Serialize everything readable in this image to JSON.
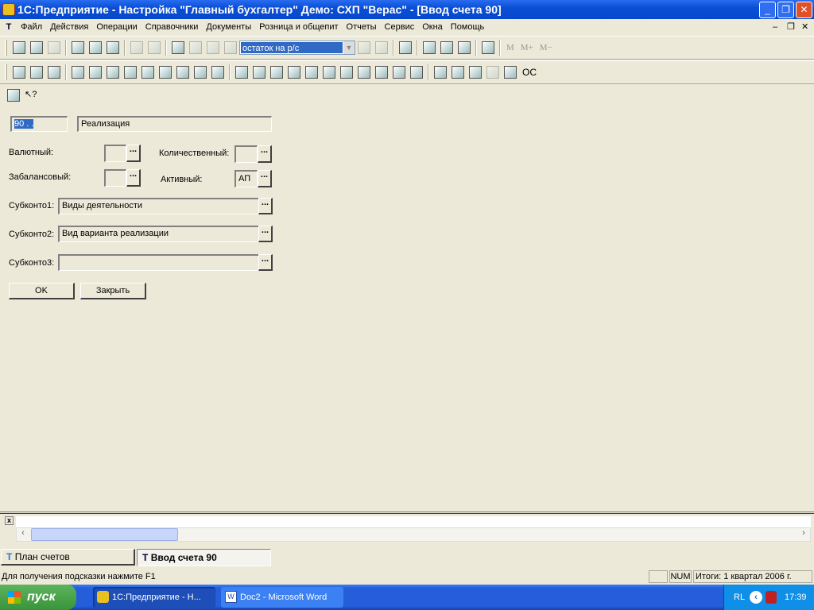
{
  "window": {
    "title": "1С:Предприятие - Настройка \"Главный бухгалтер\" Демо: СХП \"Верас\" - [Ввод счета 90]"
  },
  "menu": [
    "Файл",
    "Действия",
    "Операции",
    "Справочники",
    "Документы",
    "Розница и общепит",
    "Отчеты",
    "Сервис",
    "Окна",
    "Помощь"
  ],
  "menu_logo": "T",
  "toolbar1": {
    "search_combo": "остаток на р/с",
    "memory_buttons": [
      "M",
      "M+",
      "M−"
    ]
  },
  "toolbar1_icons": [
    "new-icon",
    "open-icon",
    "save-icon",
    "|",
    "cut-icon",
    "copy-icon",
    "paste-icon",
    "|",
    "print-icon",
    "print-preview-icon",
    "|",
    "key-icon",
    "undo-icon",
    "redo-icon",
    "find-icon",
    "COMBO",
    "find-next-icon",
    "find-prev-icon",
    "|",
    "help-icon",
    "|",
    "calculator-icon",
    "calendar-icon",
    "chart-icon",
    "|",
    "book-icon"
  ],
  "toolbar2_icons": [
    "dt-kt-icon",
    "dt-kt-red-icon",
    "chart-of-accounts-icon",
    "|",
    "journal-icon",
    "reference-icon",
    "chess-icon",
    "table-icon",
    "text-icon",
    "text-arrow-icon",
    "text-doc-icon",
    "text-edit-icon",
    "text-list-icon",
    "|",
    "payment-icon",
    "cash-icon",
    "invoice-icon",
    "grid-icon",
    "account-icon",
    "act-icon",
    "edit-icon",
    "goods-icon",
    "list-icon",
    "balance-icon",
    "people-icon",
    "|",
    "user-icon",
    "face-icon",
    "currency-icon",
    "printer-icon",
    "scanner-icon"
  ],
  "toolbar2_text": "OC",
  "form": {
    "code": "90 .  .",
    "name": "Реализация",
    "currency_label": "Валютный:",
    "currency_value": "",
    "quantity_label": "Количественный:",
    "quantity_value": "",
    "offbalance_label": "Забалансовый:",
    "offbalance_value": "",
    "active_label": "Активный:",
    "active_value": "АП",
    "subconto1_label": "Субконто1:",
    "subconto1_value": "Виды деятельности",
    "subconto2_label": "Субконто2:",
    "subconto2_value": "Вид варианта реализации",
    "subconto3_label": "Субконто3:",
    "subconto3_value": "",
    "ok": "OK",
    "close": "Закрыть",
    "dots": "..."
  },
  "window_tabs": [
    "План счетов",
    "Ввод счета 90"
  ],
  "status": {
    "hint": "Для получения подсказки нажмите F1",
    "num": "NUM",
    "totals": "Итоги: 1 квартал 2006 г."
  },
  "taskbar": {
    "start": "пуск",
    "tasks": [
      "1С:Предприятие - Н...",
      "Doc2 - Microsoft Word"
    ],
    "lang": "RL",
    "clock": "17:39"
  }
}
